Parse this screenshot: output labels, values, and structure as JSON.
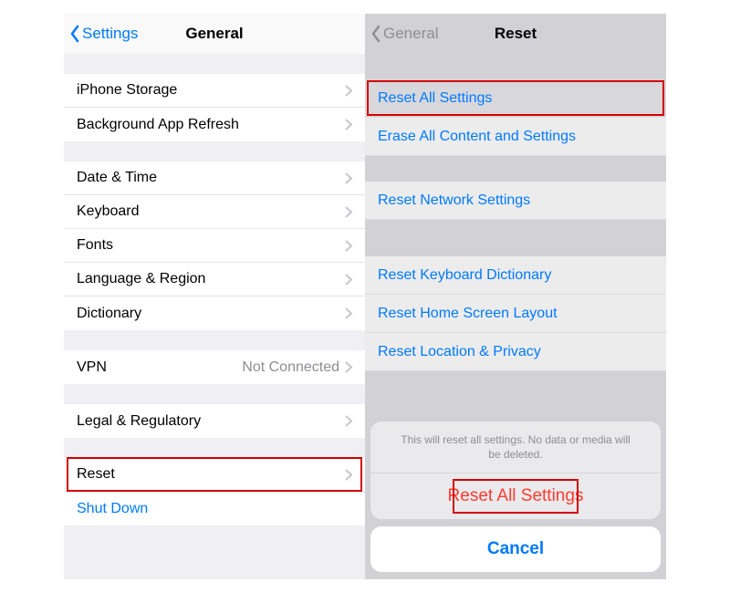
{
  "left": {
    "nav": {
      "back": "Settings",
      "title": "General"
    },
    "group1": [
      {
        "label": "iPhone Storage"
      },
      {
        "label": "Background App Refresh"
      }
    ],
    "group2": [
      {
        "label": "Date & Time"
      },
      {
        "label": "Keyboard"
      },
      {
        "label": "Fonts"
      },
      {
        "label": "Language & Region"
      },
      {
        "label": "Dictionary"
      }
    ],
    "group3": [
      {
        "label": "VPN",
        "detail": "Not Connected"
      }
    ],
    "group4": [
      {
        "label": "Legal & Regulatory"
      }
    ],
    "group5": [
      {
        "label": "Reset"
      },
      {
        "label": "Shut Down",
        "blue": true,
        "noDisc": true
      }
    ]
  },
  "right": {
    "nav": {
      "back": "General",
      "title": "Reset"
    },
    "group1": [
      {
        "label": "Reset All Settings"
      },
      {
        "label": "Erase All Content and Settings"
      }
    ],
    "group2": [
      {
        "label": "Reset Network Settings"
      }
    ],
    "group3": [
      {
        "label": "Reset Keyboard Dictionary"
      },
      {
        "label": "Reset Home Screen Layout"
      },
      {
        "label": "Reset Location & Privacy"
      }
    ],
    "sheet": {
      "message": "This will reset all settings. No data or media will be deleted.",
      "destructive": "Reset All Settings",
      "cancel": "Cancel"
    }
  }
}
